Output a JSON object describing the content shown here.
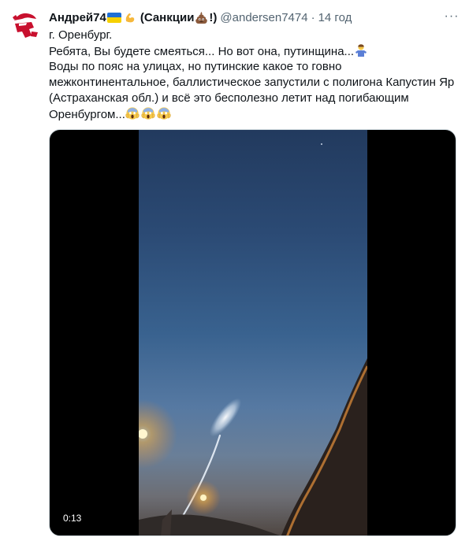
{
  "tweet": {
    "author": {
      "name": "Андрей74",
      "name_suffix_open": "(Санкции",
      "name_suffix_close": "!)",
      "handle": "@andersen7474",
      "separator": "·",
      "time": "14 год"
    },
    "text": {
      "line1": "г. Оренбург.",
      "line2": "Ребята, Вы будете смеяться... Но вот она, путинщина...",
      "line3": "Воды по пояс на улицах, но путинские какое то говно",
      "line4": "межконтинентальное, баллистическое запустили с полигона Капустин Яр",
      "line5": "(Астраханская обл.) и всё это бесполезно летит над погибающим",
      "line6": "Оренбургом..."
    },
    "media": {
      "video_time": "0:13"
    },
    "more_icon": "···"
  },
  "colors": {
    "text": "#0f1419",
    "secondary": "#536471",
    "border": "#cfd9de"
  },
  "icons": [
    "avatar-logo",
    "ukraine-flag-icon",
    "flexed-biceps-icon",
    "pile-of-poo-icon",
    "person-shrugging-icon",
    "face-screaming-icon",
    "more-icon"
  ]
}
